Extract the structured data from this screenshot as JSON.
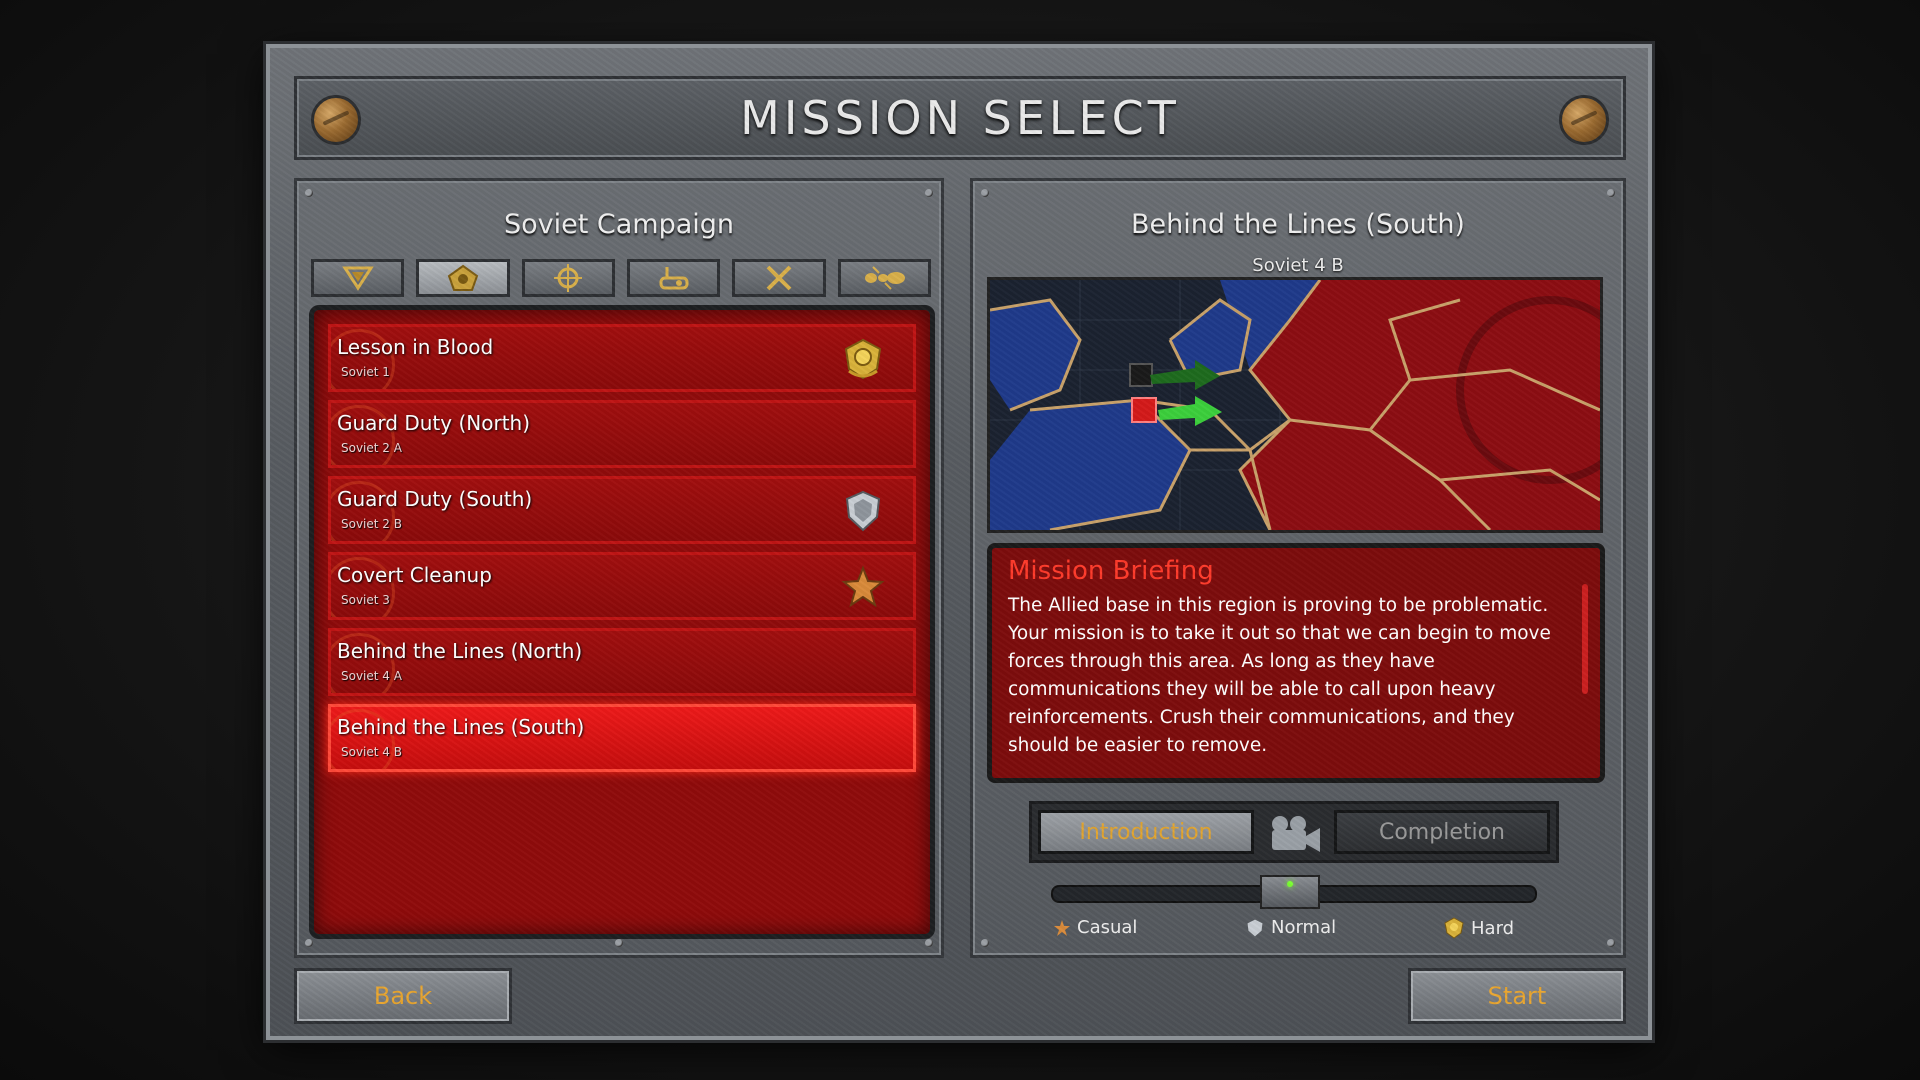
{
  "header": {
    "title": "MISSION SELECT"
  },
  "campaign": {
    "title": "Soviet Campaign",
    "category_tabs": [
      {
        "icon": "soviet-hammer-icon",
        "active": false
      },
      {
        "icon": "pentagon-emblem-icon",
        "active": true
      },
      {
        "icon": "crosshair-icon",
        "active": false
      },
      {
        "icon": "wrench-tank-icon",
        "active": false
      },
      {
        "icon": "tools-icon",
        "active": false
      },
      {
        "icon": "ant-icon",
        "active": false
      }
    ],
    "missions": [
      {
        "name": "Lesson in Blood",
        "sub": "Soviet 1",
        "medal": "gold-medal-icon",
        "selected": false
      },
      {
        "name": "Guard Duty (North)",
        "sub": "Soviet 2 A",
        "medal": "",
        "selected": false
      },
      {
        "name": "Guard Duty (South)",
        "sub": "Soviet 2 B",
        "medal": "silver-medal-icon",
        "selected": false
      },
      {
        "name": "Covert Cleanup",
        "sub": "Soviet 3",
        "medal": "bronze-star-icon",
        "selected": false
      },
      {
        "name": "Behind the Lines (North)",
        "sub": "Soviet 4 A",
        "medal": "",
        "selected": false
      },
      {
        "name": "Behind the Lines (South)",
        "sub": "Soviet 4 B",
        "medal": "",
        "selected": true
      }
    ]
  },
  "detail": {
    "title": "Behind the Lines (South)",
    "subtitle": "Soviet 4 B",
    "briefing_title": "Mission Briefing",
    "briefing_text": "The Allied base in this region is proving to be problematic. Your mission is to take it out so that we can begin to move forces through this area. As long as they have communications they will be able to call upon heavy reinforcements. Crush their communications, and they should be easier to remove.",
    "intro_label": "Introduction",
    "completion_label": "Completion",
    "difficulty": {
      "options": [
        "Casual",
        "Normal",
        "Hard"
      ],
      "selected": "Normal"
    }
  },
  "footer": {
    "back_label": "Back",
    "start_label": "Start"
  },
  "colors": {
    "accent": "#e9a630",
    "list_red": "#8f0b0b",
    "selected_red": "#e21414",
    "briefing_title": "#ff3b2b"
  }
}
